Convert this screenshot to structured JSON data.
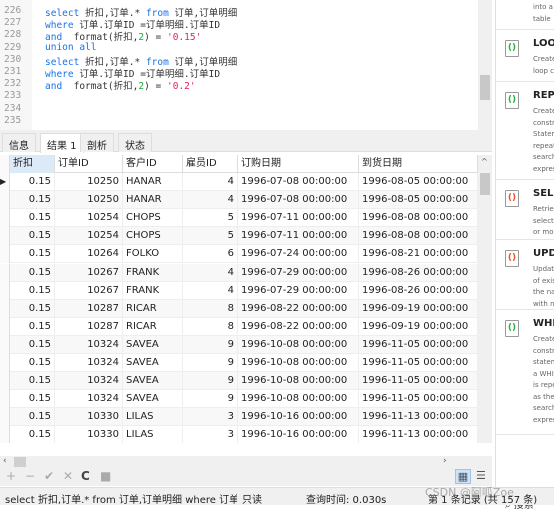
{
  "editor": {
    "line_numbers": [
      "226",
      "227",
      "228",
      "229",
      "230",
      "231",
      "232",
      "233",
      "234",
      "235"
    ],
    "lines": [
      [
        [
          "kw",
          "select"
        ],
        [
          "t",
          " 折扣,订单.* "
        ],
        [
          "kw",
          "from"
        ],
        [
          "t",
          " 订单,订单明细"
        ]
      ],
      [
        [
          "kw",
          "where"
        ],
        [
          "t",
          " 订单.订单ID =订单明细.订单ID"
        ]
      ],
      [
        [
          "kw",
          "and"
        ],
        [
          "t",
          "  format(折扣,"
        ],
        [
          "num",
          "2"
        ],
        [
          "t",
          ") = "
        ],
        [
          "str",
          "'0.15'"
        ]
      ],
      [
        [
          "kw",
          "union all"
        ]
      ],
      [
        [
          "kw",
          "select"
        ],
        [
          "t",
          " 折扣,订单.* "
        ],
        [
          "kw",
          "from"
        ],
        [
          "t",
          " 订单,订单明细"
        ]
      ],
      [
        [
          "kw",
          "where"
        ],
        [
          "t",
          " 订单.订单ID =订单明细.订单ID"
        ]
      ],
      [
        [
          "kw",
          "and"
        ],
        [
          "t",
          "  format(折扣,"
        ],
        [
          "num",
          "2"
        ],
        [
          "t",
          ") = "
        ],
        [
          "str",
          "'0.2'"
        ]
      ]
    ]
  },
  "tabs": [
    "信息",
    "结果 1",
    "剖析",
    "状态"
  ],
  "active_tab": "结果 1",
  "table": {
    "columns": [
      "折扣",
      "订单ID",
      "客户ID",
      "雇员ID",
      "订购日期",
      "到货日期"
    ],
    "rows": [
      [
        "0.15",
        "10250",
        "HANAR",
        "4",
        "1996-07-08 00:00:00",
        "1996-08-05 00:00:00"
      ],
      [
        "0.15",
        "10250",
        "HANAR",
        "4",
        "1996-07-08 00:00:00",
        "1996-08-05 00:00:00"
      ],
      [
        "0.15",
        "10254",
        "CHOPS",
        "5",
        "1996-07-11 00:00:00",
        "1996-08-08 00:00:00"
      ],
      [
        "0.15",
        "10254",
        "CHOPS",
        "5",
        "1996-07-11 00:00:00",
        "1996-08-08 00:00:00"
      ],
      [
        "0.15",
        "10264",
        "FOLKO",
        "6",
        "1996-07-24 00:00:00",
        "1996-08-21 00:00:00"
      ],
      [
        "0.15",
        "10267",
        "FRANK",
        "4",
        "1996-07-29 00:00:00",
        "1996-08-26 00:00:00"
      ],
      [
        "0.15",
        "10267",
        "FRANK",
        "4",
        "1996-07-29 00:00:00",
        "1996-08-26 00:00:00"
      ],
      [
        "0.15",
        "10287",
        "RICAR",
        "8",
        "1996-08-22 00:00:00",
        "1996-09-19 00:00:00"
      ],
      [
        "0.15",
        "10287",
        "RICAR",
        "8",
        "1996-08-22 00:00:00",
        "1996-09-19 00:00:00"
      ],
      [
        "0.15",
        "10324",
        "SAVEA",
        "9",
        "1996-10-08 00:00:00",
        "1996-11-05 00:00:00"
      ],
      [
        "0.15",
        "10324",
        "SAVEA",
        "9",
        "1996-10-08 00:00:00",
        "1996-11-05 00:00:00"
      ],
      [
        "0.15",
        "10324",
        "SAVEA",
        "9",
        "1996-10-08 00:00:00",
        "1996-11-05 00:00:00"
      ],
      [
        "0.15",
        "10324",
        "SAVEA",
        "9",
        "1996-10-08 00:00:00",
        "1996-11-05 00:00:00"
      ],
      [
        "0.15",
        "10330",
        "LILAS",
        "3",
        "1996-10-16 00:00:00",
        "1996-11-13 00:00:00"
      ],
      [
        "0.15",
        "10330",
        "LILAS",
        "3",
        "1996-10-16 00:00:00",
        "1996-11-13 00:00:00"
      ]
    ]
  },
  "toolbar": {
    "add": "+",
    "remove": "−",
    "apply": "✔",
    "cancel": "✕",
    "refresh": "C",
    "stop": "■"
  },
  "status": {
    "sql": "select 折扣,订单.* from 订单,订单明细 where 订单.订",
    "mode": "只读",
    "query_time": "查询时间: 0.030s",
    "record": "第 1 条记录 (共 157 条)"
  },
  "snippets": [
    {
      "title": "",
      "desc": "into a\ntable",
      "icon": "snippet-green"
    },
    {
      "title": "LOO",
      "desc": "Create\nloop c",
      "icon": "snippet-green"
    },
    {
      "title": "REP",
      "desc": "Create\nconstr\nStatem\nrepeat\nsearch\nexpres",
      "icon": "snippet-green"
    },
    {
      "title": "SELE",
      "desc": "Retriev\nselecte\nor mo",
      "icon": "snippet-color"
    },
    {
      "title": "UPD",
      "desc": "Updat\nof exis\nthe na\nwith n",
      "icon": "snippet-color"
    },
    {
      "title": "WHI",
      "desc": "Create\nconstr\nstatem\na WHI\nis repe\nas the\nsearch\nexpres",
      "icon": "snippet-green"
    }
  ],
  "search_label": "搜索",
  "watermark": "CSDN @阿呱Zoe"
}
